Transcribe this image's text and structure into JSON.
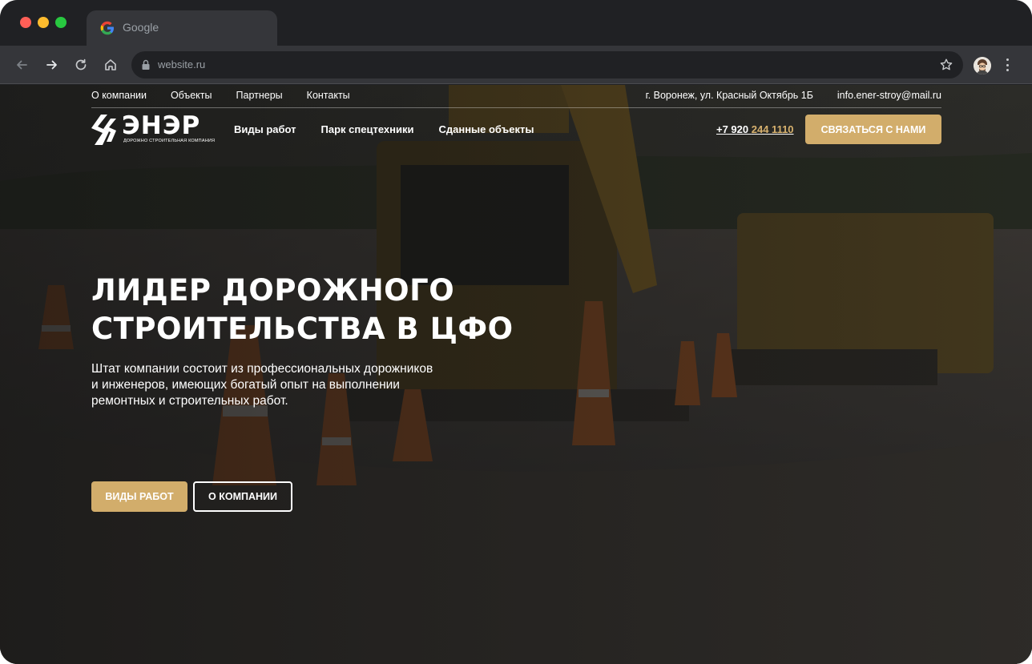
{
  "browser": {
    "tab_title": "Google",
    "url": "website.ru"
  },
  "top_nav": {
    "links": [
      "О компании",
      "Объекты",
      "Партнеры",
      "Контакты"
    ],
    "address": "г. Воронеж, ул. Красный Октябрь 1Б",
    "email": "info.ener-stroy@mail.ru"
  },
  "main_nav": {
    "logo_text": "ЭНЭР",
    "logo_subtitle": "ДОРОЖНО СТРОИТЕЛЬНАЯ КОМПАНИЯ",
    "menu": [
      "Виды работ",
      "Парк спецтехники",
      "Сданные объекты"
    ],
    "phone_prefix": "+7 920 ",
    "phone_accent": "244 1110",
    "cta_label": "СВЯЗАТЬСЯ С НАМИ"
  },
  "hero": {
    "title_line1": "ЛИДЕР ДОРОЖНОГО",
    "title_line2": "СТРОИТЕЛЬСТВА В ЦФО",
    "text_line1": "Штат компании состоит из профессиональных дорожников",
    "text_line2": "и инженеров, имеющих богатый опыт на выполнении",
    "text_line3": "ремонтных и строительных работ.",
    "primary_button": "ВИДЫ РАБОТ",
    "secondary_button": "О КОМПАНИИ"
  },
  "colors": {
    "accent": "#d2ad6b",
    "chrome_dark": "#202124",
    "chrome_toolbar": "#35363a"
  },
  "icons": [
    "google-g-icon",
    "back-arrow-icon",
    "forward-arrow-icon",
    "reload-icon",
    "home-icon",
    "lock-icon",
    "star-icon",
    "profile-avatar",
    "kebab-menu-icon",
    "logo-mark-icon"
  ]
}
